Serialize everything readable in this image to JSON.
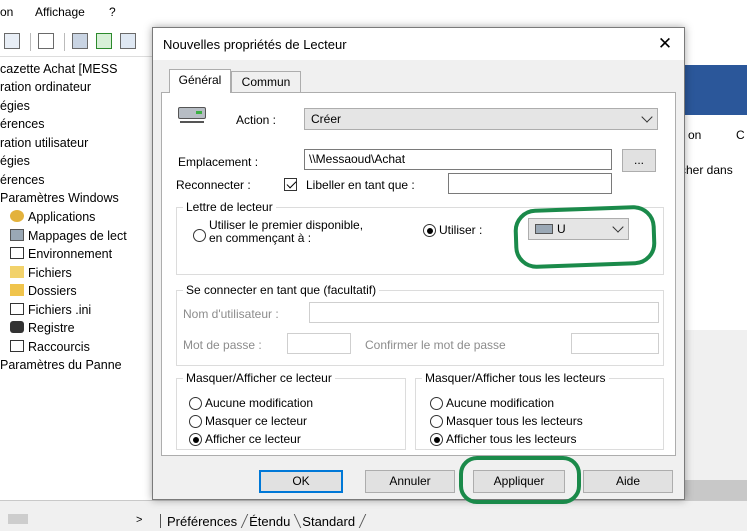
{
  "background": {
    "menu": [
      "on",
      "Affichage",
      "?"
    ],
    "tree_items": [
      {
        "label": "cazette Achat [MESS",
        "icon": "none"
      },
      {
        "label": "ration ordinateur",
        "icon": "none"
      },
      {
        "label": "égies",
        "icon": "none"
      },
      {
        "label": "érences",
        "icon": "none"
      },
      {
        "label": "ration utilisateur",
        "icon": "none"
      },
      {
        "label": "égies",
        "icon": "none"
      },
      {
        "label": "érences",
        "icon": "none"
      },
      {
        "label": "Paramètres Windows",
        "icon": "none"
      },
      {
        "label": "Applications",
        "icon": "applications-icon"
      },
      {
        "label": "Mappages de lect",
        "icon": "drive-map-icon"
      },
      {
        "label": "Environnement",
        "icon": "environment-icon"
      },
      {
        "label": "Fichiers",
        "icon": "files-icon"
      },
      {
        "label": "Dossiers",
        "icon": "folders-icon"
      },
      {
        "label": "Fichiers .ini",
        "icon": "ini-file-icon"
      },
      {
        "label": "Registre",
        "icon": "registry-icon"
      },
      {
        "label": "Raccourcis",
        "icon": "shortcut-icon"
      },
      {
        "label": "Paramètres du Panne",
        "icon": "none"
      }
    ],
    "right_columns": [
      "on",
      "C"
    ],
    "right_partial_text": "cher dans",
    "bottom_tabs": [
      "Préférences",
      "Étendu",
      "Standard"
    ]
  },
  "dialog": {
    "title": "Nouvelles propriétés de Lecteur",
    "tabs": [
      "Général",
      "Commun"
    ],
    "action": {
      "label": "Action :",
      "value": "Créer"
    },
    "location": {
      "label": "Emplacement :",
      "value": "\\\\Messaoud\\Achat",
      "browse_label": "..."
    },
    "reconnect": {
      "label": "Reconnecter :",
      "checked": true
    },
    "labelas": {
      "label": "Libeller en tant que :",
      "value": ""
    },
    "drive_letter": {
      "group_title": "Lettre de lecteur",
      "first_available_line1": "Utiliser le premier disponible,",
      "first_available_line2": "en commençant à :",
      "use_label": "Utiliser :",
      "use_selected": true,
      "drive_value": "U"
    },
    "connect_as": {
      "group_title": "Se connecter en tant que (facultatif)",
      "username_label": "Nom d'utilisateur :",
      "password_label": "Mot de passe :",
      "confirm_label": "Confirmer le mot de passe"
    },
    "hide_this": {
      "group_title": "Masquer/Afficher ce lecteur",
      "options": [
        "Aucune modification",
        "Masquer ce lecteur",
        "Afficher ce lecteur"
      ],
      "selected_index": 2
    },
    "hide_all": {
      "group_title": "Masquer/Afficher tous les lecteurs",
      "options": [
        "Aucune modification",
        "Masquer tous les lecteurs",
        "Afficher tous les lecteurs"
      ],
      "selected_index": 2
    },
    "buttons": {
      "ok": "OK",
      "cancel": "Annuler",
      "apply": "Appliquer",
      "help": "Aide"
    }
  },
  "annotation_color": "#1a8a4a"
}
